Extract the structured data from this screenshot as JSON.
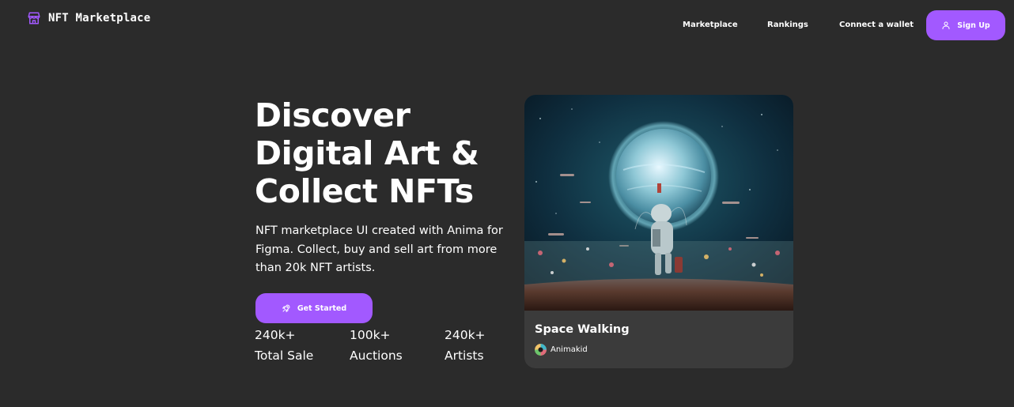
{
  "brand": {
    "name": "NFT Marketplace",
    "icon": "storefront-icon",
    "accent": "#a259ff"
  },
  "nav": {
    "links": [
      "Marketplace",
      "Rankings",
      "Connect a wallet"
    ],
    "signup_label": "Sign Up",
    "signup_icon": "user-icon"
  },
  "hero": {
    "title_lines": [
      "Discover",
      "Digital Art &",
      "Collect NFTs"
    ],
    "description": "NFT marketplace UI created with Anima for Figma. Collect, buy and sell art from more than 20k NFT artists.",
    "cta_label": "Get Started",
    "cta_icon": "rocket-icon",
    "stats": [
      {
        "value": "240k+",
        "label": "Total Sale"
      },
      {
        "value": "100k+",
        "label": "Auctions"
      },
      {
        "value": "240k+",
        "label": "Artists"
      }
    ]
  },
  "featured": {
    "title": "Space Walking",
    "artist": "Animakid",
    "image": "astronaut-planet-artwork"
  },
  "colors": {
    "background": "#2b2b2b",
    "card": "#3b3b3b",
    "accent": "#a259ff"
  }
}
